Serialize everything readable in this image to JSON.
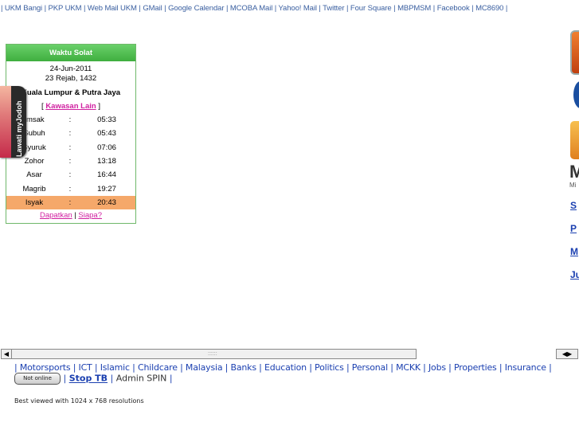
{
  "top_links": [
    "UKM Bangi",
    "PKP UKM",
    "Web Mail UKM",
    "GMail",
    "Google Calendar",
    "MCOBA Mail",
    "Yahoo! Mail",
    "Twitter",
    "Four Square",
    "MBPMSM",
    "Facebook",
    "MC8690"
  ],
  "solat": {
    "title": "Waktu Solat",
    "date_greg": "24-Jun-2011",
    "date_hijri": "23 Rejab, 1432",
    "city": "Kuala Lumpur & Putra Jaya",
    "kawasan_link": "Kawasan Lain",
    "bracket_open": "[",
    "bracket_close": "]",
    "times": [
      {
        "name": "Imsak",
        "time": "05:33"
      },
      {
        "name": "Subuh",
        "time": "05:43"
      },
      {
        "name": "Syuruk",
        "time": "07:06"
      },
      {
        "name": "Zohor",
        "time": "13:18"
      },
      {
        "name": "Asar",
        "time": "16:44"
      },
      {
        "name": "Magrib",
        "time": "19:27"
      },
      {
        "name": "Isyak",
        "time": "20:43"
      }
    ],
    "colon": ":",
    "dapatkan": "Dapatkan",
    "siapa": "Siapa?",
    "sep": "|"
  },
  "jodoh_label": "Lawati myJodoh",
  "right_col": {
    "m_letter": "M",
    "m_small": "Mi",
    "links": [
      "S",
      "P",
      "M",
      "Ju"
    ]
  },
  "scrollbar": {
    "grip": "::::::"
  },
  "categories": [
    "Motorsports",
    "ICT",
    "Islamic",
    "Childcare",
    "Malaysia",
    "Banks",
    "Education",
    "Politics",
    "Personal",
    "MCKK",
    "Jobs",
    "Properties",
    "Insurance"
  ],
  "status_badge": "Not online",
  "stop_tb": "Stop TB",
  "admin_spin": "Admin SPIN",
  "best_viewed": "Best viewed with 1024 x 768 resolutions",
  "colors": {
    "green_header": "#4cbf4c",
    "highlight_row": "#f5a86a",
    "link_blue": "#1a3fb0",
    "pink_link": "#d020a0"
  }
}
